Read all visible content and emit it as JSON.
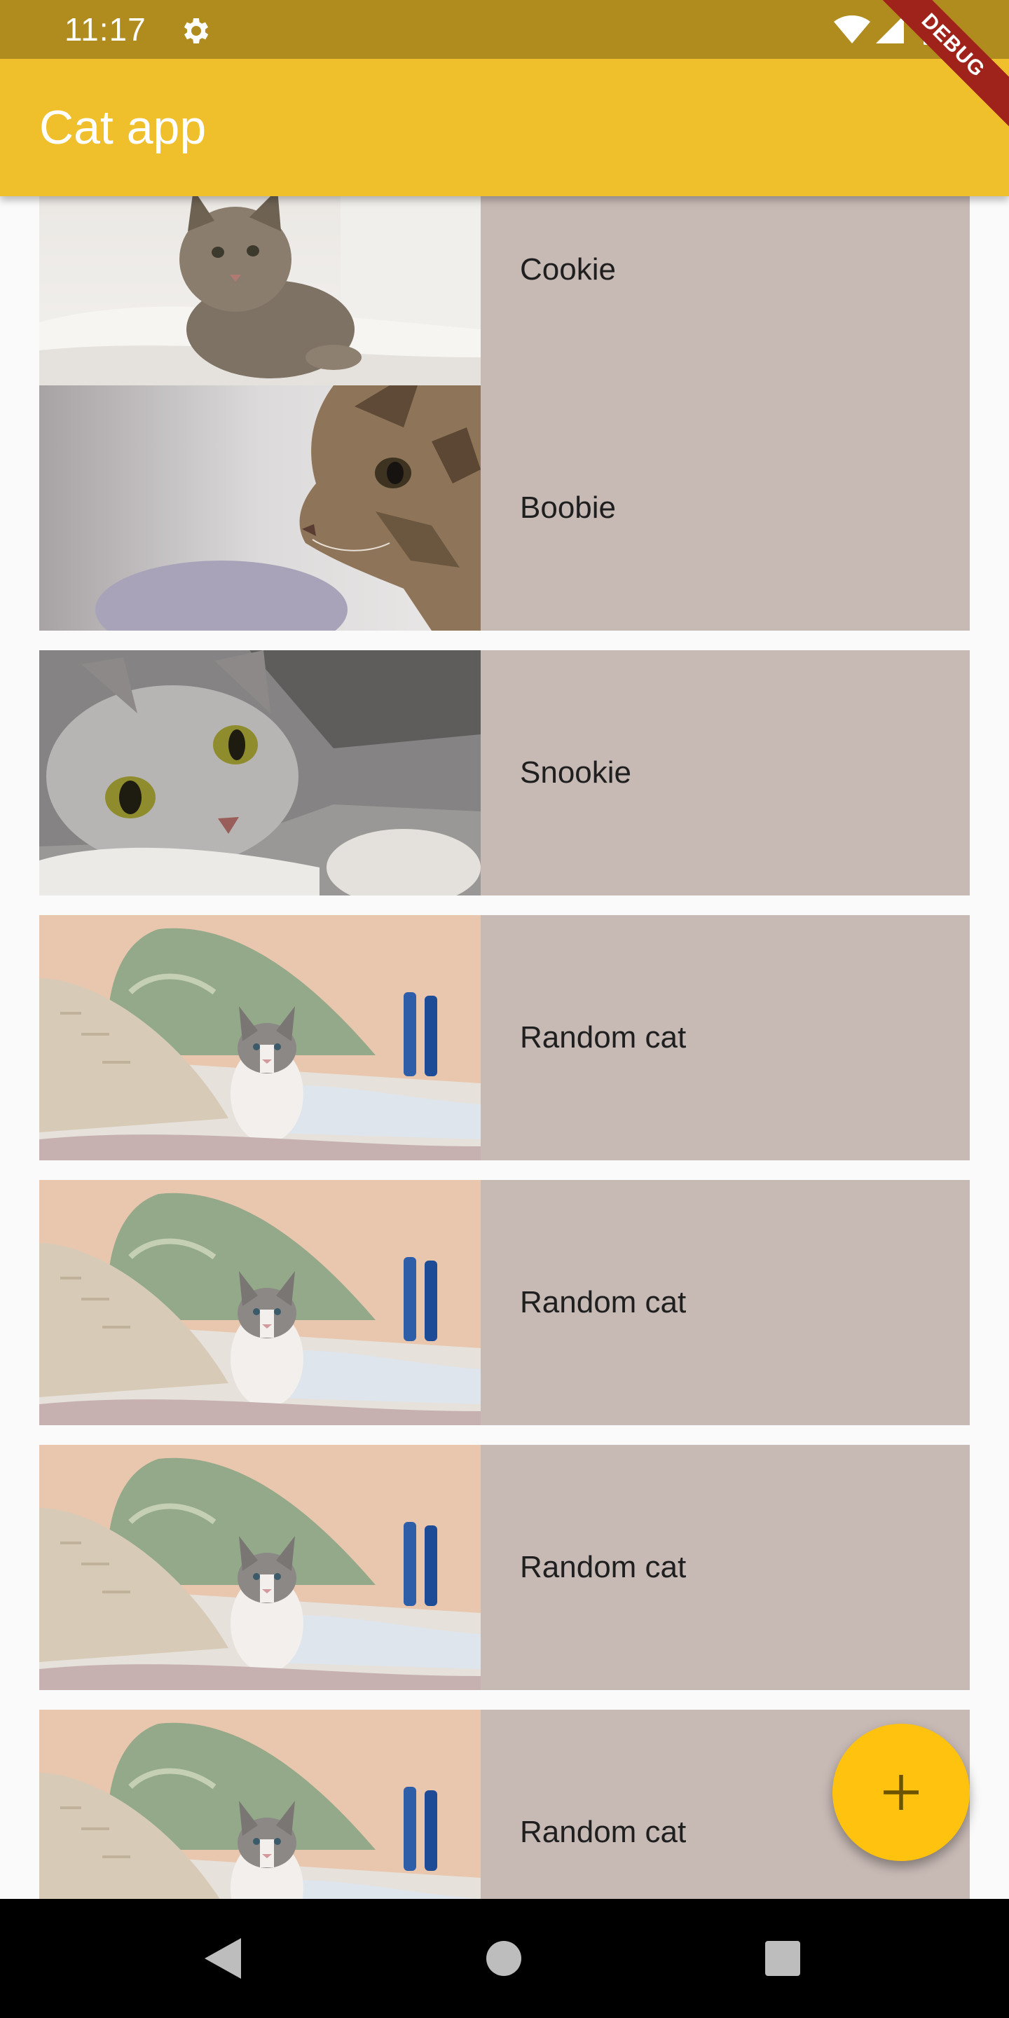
{
  "status_bar": {
    "time": "11:17",
    "background": "#b08c1e"
  },
  "app_bar": {
    "title": "Cat app",
    "background": "#f0c02c"
  },
  "debug_banner": "DEBUG",
  "cats": [
    {
      "name": "Cookie",
      "image_icon": "kitten-on-blanket-photo"
    },
    {
      "name": "Boobie",
      "image_icon": "tabby-cat-profile-photo"
    },
    {
      "name": "Snookie",
      "image_icon": "grey-cat-lying-photo"
    },
    {
      "name": "Random cat",
      "image_icon": "kitten-on-bed-photo"
    },
    {
      "name": "Random cat",
      "image_icon": "kitten-on-bed-photo"
    },
    {
      "name": "Random cat",
      "image_icon": "kitten-on-bed-photo"
    },
    {
      "name": "Random cat",
      "image_icon": "kitten-on-bed-photo"
    }
  ],
  "colors": {
    "card_background": "#c7b9b4",
    "fab": "#ffc20e",
    "page_background": "#fafafa"
  },
  "fab": {
    "icon": "plus-icon"
  },
  "nav": {
    "back_icon": "back-icon",
    "home_icon": "home-icon",
    "recents_icon": "recents-icon"
  }
}
